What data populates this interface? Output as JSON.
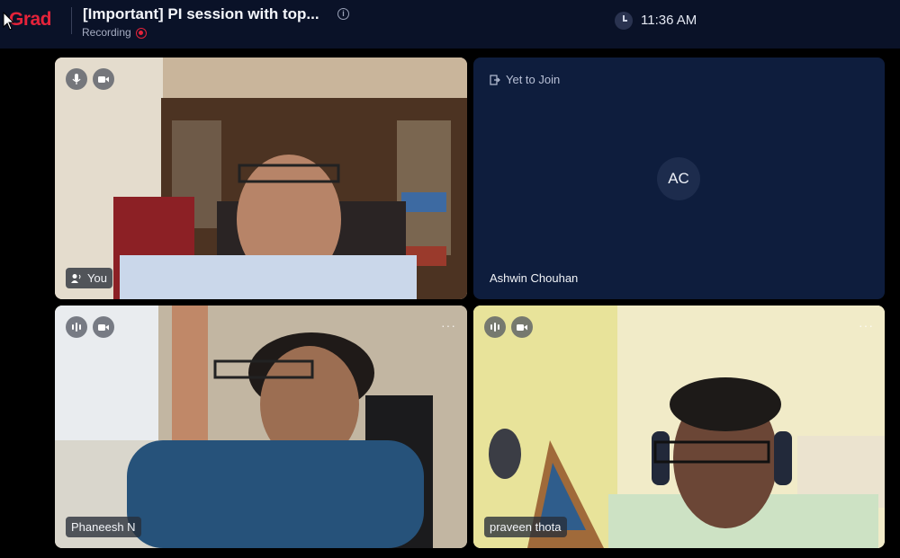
{
  "header": {
    "logo_text": "Grad",
    "meeting_title": "[Important] PI session with top...",
    "recording_label": "Recording",
    "time": "11:36 AM"
  },
  "tiles": [
    {
      "name": "You",
      "mic_icon": "microphone-icon",
      "video_icon": "video-camera-icon",
      "speaking_icon": "speaker-icon"
    },
    {
      "name": "Ashwin Chouhan",
      "status": "Yet to Join",
      "initials": "AC"
    },
    {
      "name": "Phaneesh N",
      "audio_icon": "audio-level-icon",
      "video_icon": "video-camera-icon",
      "more": "···"
    },
    {
      "name": "praveen thota",
      "audio_icon": "audio-level-icon",
      "video_icon": "video-camera-icon",
      "more": "···"
    }
  ],
  "colors": {
    "brand": "#e5233a",
    "header_bg": "#0a1228",
    "tile_dark": "#0e1d3d"
  }
}
